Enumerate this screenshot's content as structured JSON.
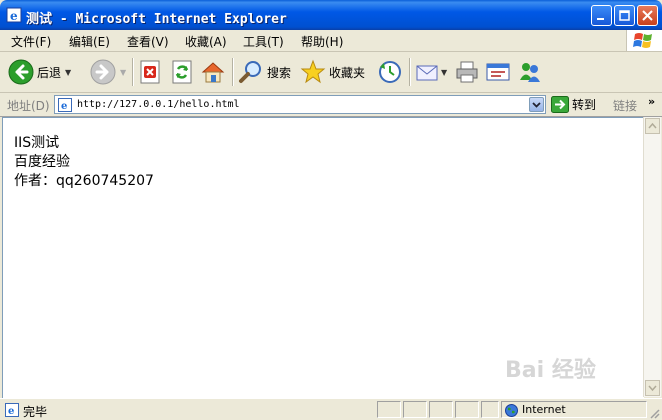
{
  "window": {
    "title": "测试 - Microsoft Internet Explorer"
  },
  "menu": {
    "items": [
      "文件(F)",
      "编辑(E)",
      "查看(V)",
      "收藏(A)",
      "工具(T)",
      "帮助(H)"
    ]
  },
  "toolbar": {
    "back_label": "后退",
    "search_label": "搜索",
    "favorites_label": "收藏夹"
  },
  "address": {
    "label": "地址(D)",
    "url": "http://127.0.0.1/hello.html",
    "go_label": "转到",
    "links_label": "链接"
  },
  "page": {
    "lines": [
      "IIS测试",
      "百度经验",
      "作者：qq260745207"
    ]
  },
  "watermark": "Bai 经验",
  "status": {
    "text": "完毕",
    "zone": "Internet"
  },
  "colors": {
    "titlebar": "#0058E6",
    "chrome": "#ECE9D8",
    "back_green": "#2C9E2C",
    "go_green": "#3AA83A"
  },
  "icons": {
    "back": "back-arrow-icon",
    "forward": "forward-arrow-icon",
    "stop": "stop-icon",
    "refresh": "refresh-icon",
    "home": "home-icon",
    "search": "search-icon",
    "favorites": "star-icon",
    "history": "history-icon",
    "mail": "mail-icon",
    "print": "printer-icon",
    "edit": "edit-icon",
    "messenger": "messenger-icon"
  }
}
